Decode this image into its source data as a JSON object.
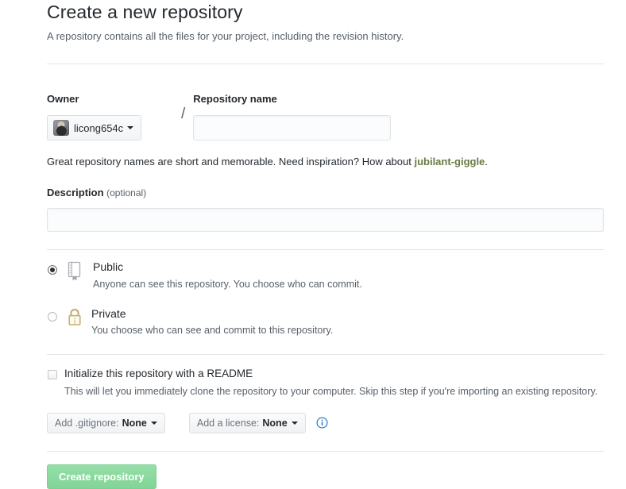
{
  "header": {
    "title": "Create a new repository",
    "subtitle": "A repository contains all the files for your project, including the revision history."
  },
  "owner": {
    "label": "Owner",
    "name": "licong654c",
    "avatar_icon": "user-avatar-image",
    "caret_icon": "chevron-down-icon",
    "separator": "/"
  },
  "repository_name": {
    "label": "Repository name",
    "value": "",
    "placeholder": ""
  },
  "name_hint": {
    "text_before": "Great repository names are short and memorable. Need inspiration? How about ",
    "suggestion": "jubilant-giggle",
    "text_after": ".",
    "suggestion_color": "#697a41"
  },
  "description": {
    "label": "Description",
    "optional_label": "(optional)",
    "value": "",
    "placeholder": ""
  },
  "visibility": {
    "options": [
      {
        "id": "public",
        "name": "Public",
        "description": "Anyone can see this repository. You choose who can commit.",
        "icon": "repo-book-icon",
        "selected": true
      },
      {
        "id": "private",
        "name": "Private",
        "description": "You choose who can see and commit to this repository.",
        "icon": "lock-icon",
        "selected": false
      }
    ]
  },
  "readme": {
    "label": "Initialize this repository with a README",
    "description": "This will let you immediately clone the repository to your computer. Skip this step if you're importing an existing repository.",
    "checked": false
  },
  "gitignore": {
    "prefix": "Add .gitignore:",
    "value": "None",
    "caret_icon": "chevron-down-icon"
  },
  "license": {
    "prefix": "Add a license:",
    "value": "None",
    "caret_icon": "chevron-down-icon"
  },
  "info": {
    "icon": "info-circle-icon",
    "color": "#0366d6"
  },
  "submit": {
    "label": "Create repository",
    "color": "#8bd7a0"
  }
}
